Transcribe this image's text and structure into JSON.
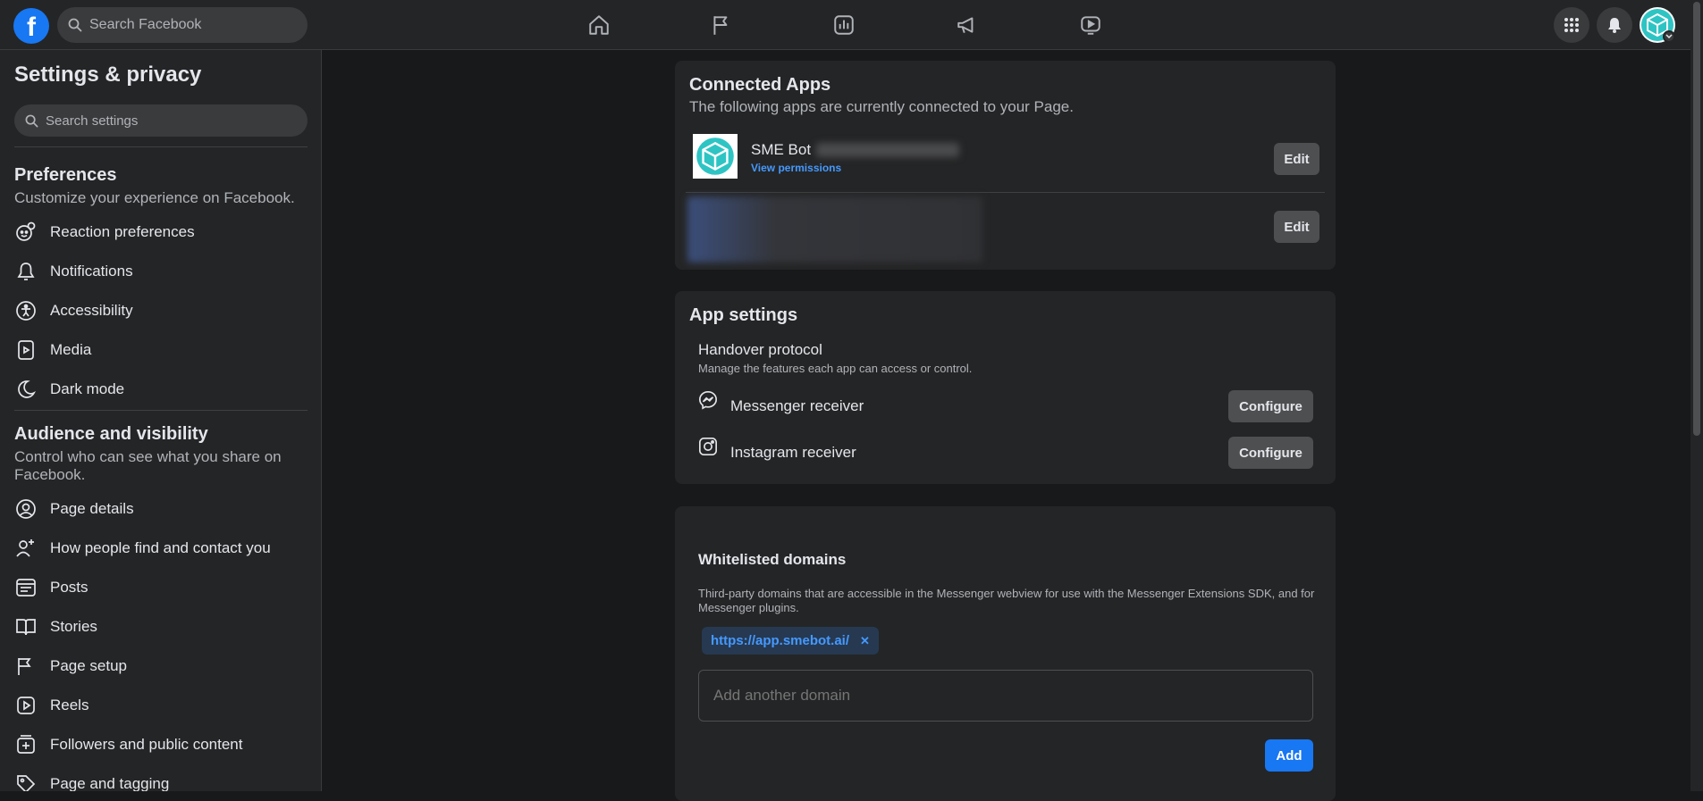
{
  "topbar": {
    "logo_letter": "f",
    "search_placeholder": "Search Facebook"
  },
  "sidebar": {
    "title": "Settings & privacy",
    "search_placeholder": "Search settings",
    "preferences": {
      "title": "Preferences",
      "subtitle": "Customize your experience on Facebook.",
      "items": [
        {
          "label": "Reaction preferences",
          "icon": "reaction-icon"
        },
        {
          "label": "Notifications",
          "icon": "bell-icon"
        },
        {
          "label": "Accessibility",
          "icon": "accessibility-icon"
        },
        {
          "label": "Media",
          "icon": "media-icon"
        },
        {
          "label": "Dark mode",
          "icon": "moon-icon"
        }
      ]
    },
    "audience": {
      "title": "Audience and visibility",
      "subtitle": "Control who can see what you share on Facebook.",
      "items": [
        {
          "label": "Page details",
          "icon": "person-icon"
        },
        {
          "label": "How people find and contact you",
          "icon": "people-icon"
        },
        {
          "label": "Posts",
          "icon": "posts-icon"
        },
        {
          "label": "Stories",
          "icon": "book-icon"
        },
        {
          "label": "Page setup",
          "icon": "flag-icon"
        },
        {
          "label": "Reels",
          "icon": "reels-icon"
        },
        {
          "label": "Followers and public content",
          "icon": "plus-box-icon"
        },
        {
          "label": "Page and tagging",
          "icon": "tag-icon"
        }
      ]
    }
  },
  "connected_apps": {
    "title": "Connected Apps",
    "subtitle": "The following apps are currently connected to your Page.",
    "apps": [
      {
        "name": "SME Bot",
        "link": "View permissions",
        "button": "Edit"
      },
      {
        "button": "Edit"
      }
    ]
  },
  "app_settings": {
    "title": "App settings",
    "handover_title": "Handover protocol",
    "handover_sub": "Manage the features each app can access or control.",
    "receivers": [
      {
        "label": "Messenger receiver",
        "button": "Configure",
        "icon": "messenger-icon"
      },
      {
        "label": "Instagram receiver",
        "button": "Configure",
        "icon": "instagram-icon"
      }
    ]
  },
  "whitelist": {
    "title": "Whitelisted domains",
    "description": "Third-party domains that are accessible in the Messenger webview for use with the Messenger Extensions SDK, and for Messenger plugins.",
    "chip": "https://app.smebot.ai/",
    "chip_remove": "✕",
    "input_placeholder": "Add another domain",
    "add_button": "Add"
  },
  "colors": {
    "accent": "#1877f2",
    "link": "#4599ff",
    "chip_bg": "#263951"
  }
}
